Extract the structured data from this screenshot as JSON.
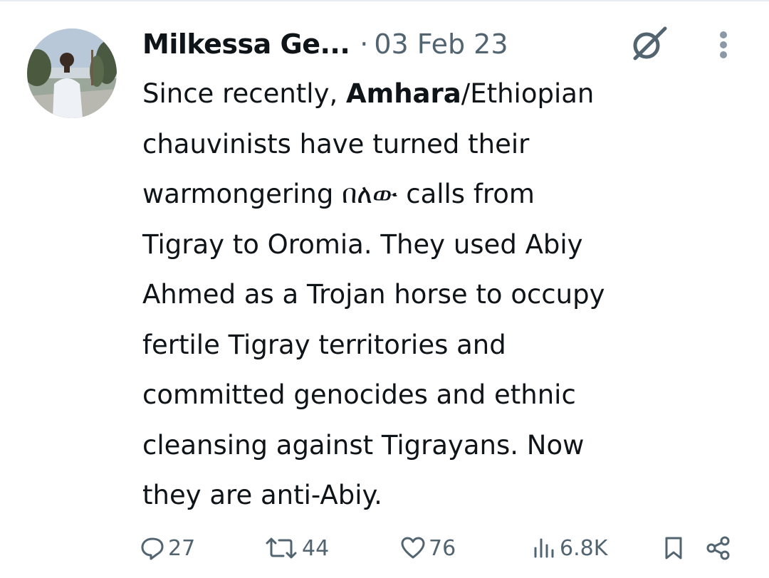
{
  "tweet": {
    "display_name": "Milkessa Ge...",
    "separator": "·",
    "date": "03 Feb 23",
    "text_lines": [
      {
        "before": "Since recently, ",
        "bold": "Amhara",
        "after": "/Ethiopian"
      },
      {
        "text": "chauvinists have turned their"
      },
      {
        "text": "warmongering በለው calls from"
      },
      {
        "text": "Tigray to Oromia. They used Abiy"
      },
      {
        "text": "Ahmed as a Trojan horse to occupy"
      },
      {
        "text": "fertile Tigray territories and"
      },
      {
        "text": "committed genocides and ethnic"
      },
      {
        "text": "cleansing against Tigrayans. Now"
      },
      {
        "text": "they are anti-Abiy."
      }
    ]
  },
  "metrics": {
    "replies": "27",
    "reposts": "44",
    "likes": "76",
    "views": "6.8K"
  },
  "icons": {
    "header": [
      "grok-icon",
      "more-options-icon"
    ],
    "actions": [
      "reply-icon",
      "repost-icon",
      "like-icon",
      "views-icon",
      "bookmark-icon",
      "share-icon"
    ]
  },
  "colors": {
    "text": "#0f1419",
    "secondary": "#536471"
  }
}
